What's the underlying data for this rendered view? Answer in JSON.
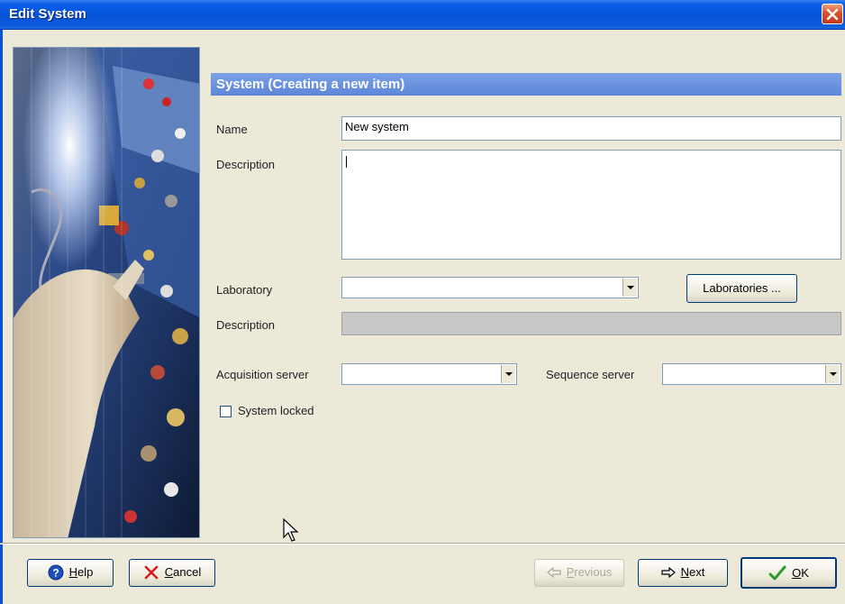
{
  "window": {
    "title": "Edit System"
  },
  "section": {
    "header": "System (Creating a new item)"
  },
  "form": {
    "name_label": "Name",
    "name_value": "New system",
    "description_label": "Description",
    "description_value": "",
    "laboratory_label": "Laboratory",
    "laboratory_value": "",
    "laboratories_button": "Laboratories ...",
    "lab_description_label": "Description",
    "lab_description_value": "",
    "acquisition_server_label": "Acquisition server",
    "acquisition_server_value": "",
    "sequence_server_label": "Sequence server",
    "sequence_server_value": "",
    "system_locked_label": "System locked",
    "system_locked_checked": false
  },
  "footer": {
    "help": "Help",
    "cancel": "Cancel",
    "previous": "Previous",
    "next": "Next",
    "ok": "OK"
  },
  "colors": {
    "title_bar": "#0553d8",
    "section_header": "#6b92dd",
    "dialog_bg": "#ece9d8"
  }
}
